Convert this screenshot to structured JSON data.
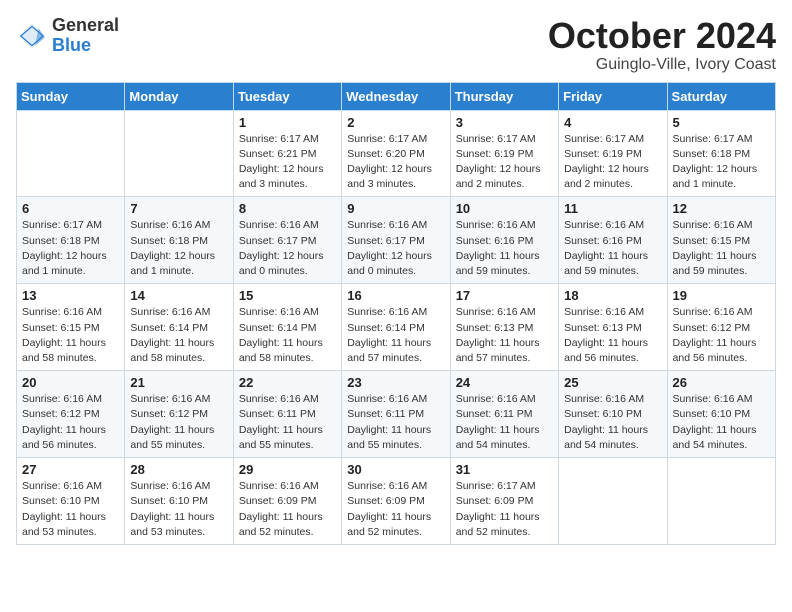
{
  "header": {
    "logo_general": "General",
    "logo_blue": "Blue",
    "month_title": "October 2024",
    "subtitle": "Guinglo-Ville, Ivory Coast"
  },
  "days_of_week": [
    "Sunday",
    "Monday",
    "Tuesday",
    "Wednesday",
    "Thursday",
    "Friday",
    "Saturday"
  ],
  "weeks": [
    [
      {
        "day": "",
        "info": ""
      },
      {
        "day": "",
        "info": ""
      },
      {
        "day": "1",
        "info": "Sunrise: 6:17 AM\nSunset: 6:21 PM\nDaylight: 12 hours and 3 minutes."
      },
      {
        "day": "2",
        "info": "Sunrise: 6:17 AM\nSunset: 6:20 PM\nDaylight: 12 hours and 3 minutes."
      },
      {
        "day": "3",
        "info": "Sunrise: 6:17 AM\nSunset: 6:19 PM\nDaylight: 12 hours and 2 minutes."
      },
      {
        "day": "4",
        "info": "Sunrise: 6:17 AM\nSunset: 6:19 PM\nDaylight: 12 hours and 2 minutes."
      },
      {
        "day": "5",
        "info": "Sunrise: 6:17 AM\nSunset: 6:18 PM\nDaylight: 12 hours and 1 minute."
      }
    ],
    [
      {
        "day": "6",
        "info": "Sunrise: 6:17 AM\nSunset: 6:18 PM\nDaylight: 12 hours and 1 minute."
      },
      {
        "day": "7",
        "info": "Sunrise: 6:16 AM\nSunset: 6:18 PM\nDaylight: 12 hours and 1 minute."
      },
      {
        "day": "8",
        "info": "Sunrise: 6:16 AM\nSunset: 6:17 PM\nDaylight: 12 hours and 0 minutes."
      },
      {
        "day": "9",
        "info": "Sunrise: 6:16 AM\nSunset: 6:17 PM\nDaylight: 12 hours and 0 minutes."
      },
      {
        "day": "10",
        "info": "Sunrise: 6:16 AM\nSunset: 6:16 PM\nDaylight: 11 hours and 59 minutes."
      },
      {
        "day": "11",
        "info": "Sunrise: 6:16 AM\nSunset: 6:16 PM\nDaylight: 11 hours and 59 minutes."
      },
      {
        "day": "12",
        "info": "Sunrise: 6:16 AM\nSunset: 6:15 PM\nDaylight: 11 hours and 59 minutes."
      }
    ],
    [
      {
        "day": "13",
        "info": "Sunrise: 6:16 AM\nSunset: 6:15 PM\nDaylight: 11 hours and 58 minutes."
      },
      {
        "day": "14",
        "info": "Sunrise: 6:16 AM\nSunset: 6:14 PM\nDaylight: 11 hours and 58 minutes."
      },
      {
        "day": "15",
        "info": "Sunrise: 6:16 AM\nSunset: 6:14 PM\nDaylight: 11 hours and 58 minutes."
      },
      {
        "day": "16",
        "info": "Sunrise: 6:16 AM\nSunset: 6:14 PM\nDaylight: 11 hours and 57 minutes."
      },
      {
        "day": "17",
        "info": "Sunrise: 6:16 AM\nSunset: 6:13 PM\nDaylight: 11 hours and 57 minutes."
      },
      {
        "day": "18",
        "info": "Sunrise: 6:16 AM\nSunset: 6:13 PM\nDaylight: 11 hours and 56 minutes."
      },
      {
        "day": "19",
        "info": "Sunrise: 6:16 AM\nSunset: 6:12 PM\nDaylight: 11 hours and 56 minutes."
      }
    ],
    [
      {
        "day": "20",
        "info": "Sunrise: 6:16 AM\nSunset: 6:12 PM\nDaylight: 11 hours and 56 minutes."
      },
      {
        "day": "21",
        "info": "Sunrise: 6:16 AM\nSunset: 6:12 PM\nDaylight: 11 hours and 55 minutes."
      },
      {
        "day": "22",
        "info": "Sunrise: 6:16 AM\nSunset: 6:11 PM\nDaylight: 11 hours and 55 minutes."
      },
      {
        "day": "23",
        "info": "Sunrise: 6:16 AM\nSunset: 6:11 PM\nDaylight: 11 hours and 55 minutes."
      },
      {
        "day": "24",
        "info": "Sunrise: 6:16 AM\nSunset: 6:11 PM\nDaylight: 11 hours and 54 minutes."
      },
      {
        "day": "25",
        "info": "Sunrise: 6:16 AM\nSunset: 6:10 PM\nDaylight: 11 hours and 54 minutes."
      },
      {
        "day": "26",
        "info": "Sunrise: 6:16 AM\nSunset: 6:10 PM\nDaylight: 11 hours and 54 minutes."
      }
    ],
    [
      {
        "day": "27",
        "info": "Sunrise: 6:16 AM\nSunset: 6:10 PM\nDaylight: 11 hours and 53 minutes."
      },
      {
        "day": "28",
        "info": "Sunrise: 6:16 AM\nSunset: 6:10 PM\nDaylight: 11 hours and 53 minutes."
      },
      {
        "day": "29",
        "info": "Sunrise: 6:16 AM\nSunset: 6:09 PM\nDaylight: 11 hours and 52 minutes."
      },
      {
        "day": "30",
        "info": "Sunrise: 6:16 AM\nSunset: 6:09 PM\nDaylight: 11 hours and 52 minutes."
      },
      {
        "day": "31",
        "info": "Sunrise: 6:17 AM\nSunset: 6:09 PM\nDaylight: 11 hours and 52 minutes."
      },
      {
        "day": "",
        "info": ""
      },
      {
        "day": "",
        "info": ""
      }
    ]
  ]
}
